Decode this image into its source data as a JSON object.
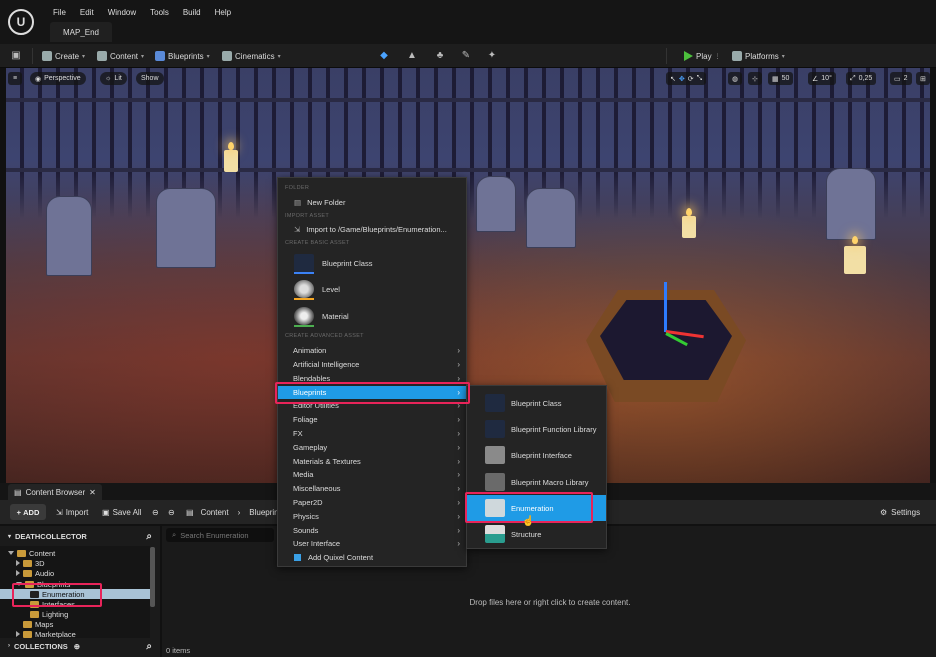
{
  "window": {
    "menu": [
      "File",
      "Edit",
      "Window",
      "Tools",
      "Build",
      "Help"
    ],
    "map_tab": "MAP_End"
  },
  "toolbar": {
    "create": "Create",
    "content": "Content",
    "blueprints": "Blueprints",
    "cinematics": "Cinematics",
    "play": "Play",
    "platforms": "Platforms"
  },
  "viewport": {
    "perspective": "Perspective",
    "lit": "Lit",
    "show": "Show",
    "grid_snap": "50",
    "rotation_snap": "10°",
    "scale_snap": "0,25",
    "camera_speed": "2"
  },
  "context_menu": {
    "sections": {
      "folder": "FOLDER",
      "import": "IMPORT ASSET",
      "basic": "CREATE BASIC ASSET",
      "advanced": "CREATE ADVANCED ASSET"
    },
    "new_folder": "New Folder",
    "import_to": "Import to /Game/Blueprints/Enumeration...",
    "basic_assets": [
      "Blueprint Class",
      "Level",
      "Material"
    ],
    "advanced_items": [
      "Animation",
      "Artificial Intelligence",
      "Blendables",
      "Blueprints",
      "Editor Utilities",
      "Foliage",
      "FX",
      "Gameplay",
      "Materials & Textures",
      "Media",
      "Miscellaneous",
      "Paper2D",
      "Physics",
      "Sounds",
      "User Interface"
    ],
    "add_quixel": "Add Quixel Content",
    "highlight_color": "#1f9be6"
  },
  "submenu": {
    "items": [
      "Blueprint Class",
      "Blueprint Function Library",
      "Blueprint Interface",
      "Blueprint Macro Library",
      "Enumeration",
      "Structure"
    ],
    "selected_index": 4
  },
  "content_browser": {
    "tab": "Content Browser",
    "add": "ADD",
    "import": "Import",
    "save_all": "Save All",
    "path": [
      "Content",
      "Blueprints"
    ],
    "settings": "Settings",
    "project": "DEATHCOLLECTOR",
    "search_placeholder": "Search Enumeration",
    "tree": [
      "Content",
      "3D",
      "Audio",
      "Blueprints",
      "Enumeration",
      "Interfaces",
      "Lighting",
      "Maps",
      "Marketplace"
    ],
    "collections": "COLLECTIONS",
    "drop_hint": "Drop files here or right click to create content.",
    "items_count": "0 items"
  },
  "annotation_color": "#e8245a"
}
